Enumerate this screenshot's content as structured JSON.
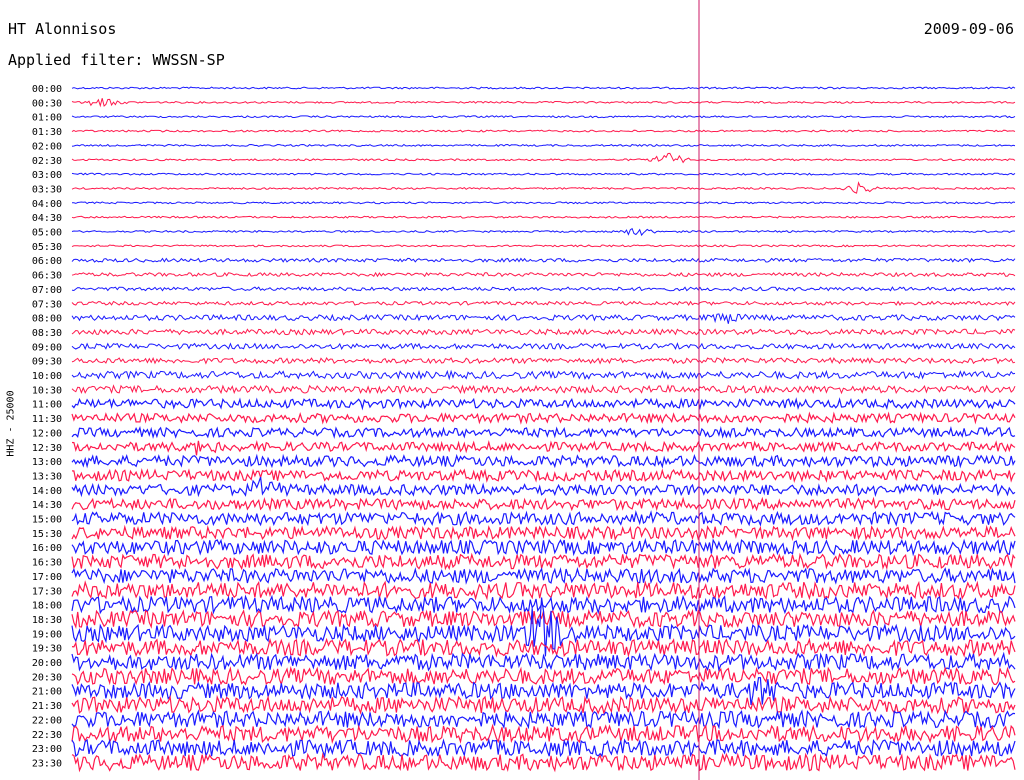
{
  "header": {
    "station": "HT Alonnisos",
    "date": "2009-09-06",
    "filter": "Applied filter: WWSSN-SP"
  },
  "chart_data": {
    "type": "line",
    "ylabel": "HHZ - 25000",
    "colors": [
      "#1a1aff",
      "#ff1a4d"
    ],
    "time_labels": [
      "00:00",
      "00:30",
      "01:00",
      "01:30",
      "02:00",
      "02:30",
      "03:00",
      "03:30",
      "04:00",
      "04:30",
      "05:00",
      "05:30",
      "06:00",
      "06:30",
      "07:00",
      "07:30",
      "08:00",
      "08:30",
      "09:00",
      "09:30",
      "10:00",
      "10:30",
      "11:00",
      "11:30",
      "12:00",
      "12:30",
      "13:00",
      "13:30",
      "14:00",
      "14:30",
      "15:00",
      "15:30",
      "16:00",
      "16:30",
      "17:00",
      "17:30",
      "18:00",
      "18:30",
      "19:00",
      "19:30",
      "20:00",
      "20:30",
      "21:00",
      "21:30",
      "22:00",
      "22:30",
      "23:00",
      "23:30"
    ],
    "noise_level": [
      1,
      1,
      1,
      1,
      1,
      1,
      1,
      1,
      1,
      1,
      1,
      1,
      2,
      2,
      2,
      2,
      3,
      3,
      3,
      3,
      4,
      4,
      5,
      5,
      5,
      5,
      6,
      6,
      6,
      6,
      7,
      7,
      8,
      8,
      8,
      9,
      9,
      9,
      9,
      9,
      9,
      9,
      9,
      9,
      9,
      9,
      9,
      9
    ],
    "events": [
      {
        "trace": 1,
        "minute": 1,
        "amplitude": 6
      },
      {
        "trace": 5,
        "minute": 19,
        "amplitude": 8
      },
      {
        "trace": 7,
        "minute": 25,
        "amplitude": 5
      },
      {
        "trace": 10,
        "minute": 18,
        "amplitude": 4
      },
      {
        "trace": 16,
        "minute": 21,
        "amplitude": 8
      },
      {
        "trace": 25,
        "minute": 4,
        "amplitude": 8
      },
      {
        "trace": 28,
        "minute": 6,
        "amplitude": 10
      },
      {
        "trace": 38,
        "minute": 15,
        "amplitude": 40
      },
      {
        "trace": 42,
        "minute": 22,
        "amplitude": 25
      }
    ]
  }
}
